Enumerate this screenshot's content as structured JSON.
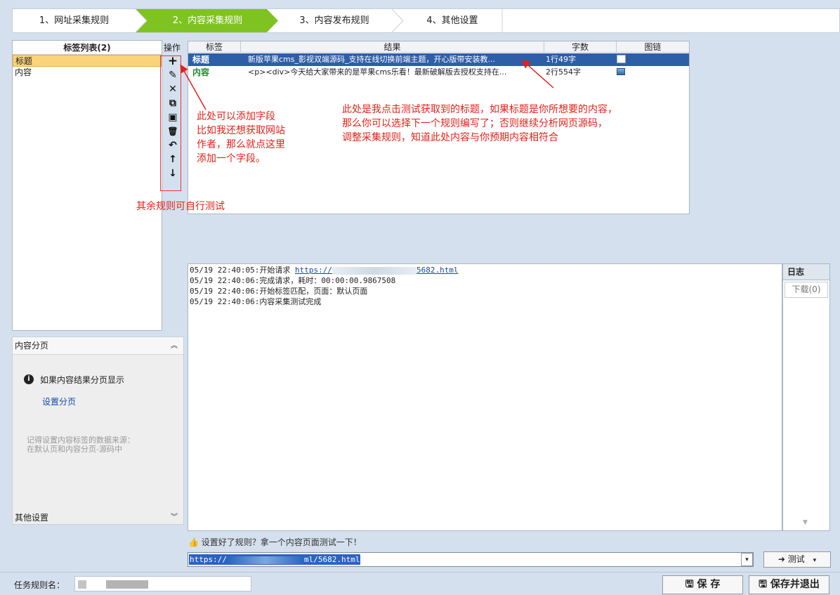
{
  "wizard": {
    "steps": [
      "1、网址采集规则",
      "2、内容采集规则",
      "3、内容发布规则",
      "4、其他设置"
    ],
    "active_color": "#7fc321"
  },
  "taglist": {
    "title": "标签列表(2)",
    "items": [
      "标题",
      "内容"
    ],
    "selected_color": "#fbd37a"
  },
  "ops": {
    "title": "操作",
    "buttons": [
      {
        "name": "add-field",
        "glyph": "+"
      },
      {
        "name": "edit",
        "glyph": "✎"
      },
      {
        "name": "delete",
        "glyph": "✕"
      },
      {
        "name": "copy",
        "glyph": "⧉"
      },
      {
        "name": "paste",
        "glyph": "▣"
      },
      {
        "name": "clear",
        "glyph": "🗑"
      },
      {
        "name": "undo",
        "glyph": "↶"
      },
      {
        "name": "move-up",
        "glyph": "↑"
      },
      {
        "name": "move-down",
        "glyph": "↓"
      }
    ]
  },
  "grid": {
    "headers": [
      "标签",
      "结果",
      "字数",
      "图链"
    ],
    "rows": [
      {
        "tag": "标题",
        "result": "新版苹果cms_影视双端源码_支持在线切换前端主题，开心版带安装教...",
        "count": "1行49字"
      },
      {
        "tag": "内容",
        "result": "<p><div>今天给大家带来的是苹果cms乐看！最新破解版去授权支持在...",
        "count": "2行554字"
      }
    ],
    "selected_color": "#2e5ea6"
  },
  "annotations": {
    "add_field": "此处可以添加字段\n比如我还想获取网站\n作者，那么就点这里\n添加一个字段。",
    "result_hint": "此处是我点击测试获取到的标题，如果标题是你所想要的内容，\n那么你可以选择下一个规则编写了；否则继续分析网页源码，\n调整采集规则，知道此处内容与你预期内容相符合",
    "other_rules": "其余规则可自行测试",
    "color": "#e32219"
  },
  "log": {
    "line1_prefix": "05/19 22:40:05:开始请求 ",
    "line1_link_a": "https://",
    "line1_link_b": "5682.html",
    "line2": "05/19 22:40:06:完成请求，耗时：00:00:00.9867508",
    "line3": "05/19 22:40:06:开始标签匹配，页面：默认页面",
    "line4": "05/19 22:40:06:内容采集测试完成",
    "tab": "日志",
    "download": "下载(0)"
  },
  "pager": {
    "title": "内容分页",
    "info": "如果内容结果分页显示",
    "link": "设置分页",
    "note": "记得设置内容标签的数据来源：\n在默认页和内容分页-源码中",
    "footer": "其他设置"
  },
  "bottom": {
    "hint": "设置好了规则？拿一个内容页面测试一下！",
    "url_prefix": "https://",
    "url_suffix": "ml/5682.html",
    "test_label": "测试",
    "task_label": "任务规则名：",
    "save": "保 存",
    "save_exit": "保存并退出"
  }
}
